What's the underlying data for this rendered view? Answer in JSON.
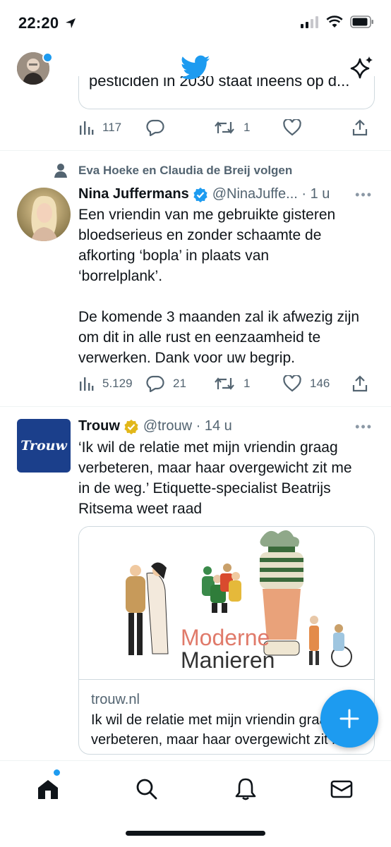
{
  "status_bar": {
    "time": "22:20"
  },
  "top_tweet": {
    "card_text": "pesticiden in 2030 staat ineens op d...",
    "views": "117",
    "replies": "",
    "retweets": "1",
    "likes": ""
  },
  "tweet1": {
    "context": "Eva Hoeke en Claudia de Breij volgen",
    "name": "Nina Juffermans",
    "handle": "@NinaJuffe... · 1 u",
    "body": "Een vriendin van me gebruikte gisteren\nbloedserieus en zonder schaamte de\nafkorting ‘bopla’ in plaats van\n‘borrelplank’.\n\nDe komende 3 maanden zal ik afwezig zijn\nom dit in alle rust en eenzaamheid te\nverwerken. Dank voor uw begrip.",
    "views": "5.129",
    "replies": "21",
    "retweets": "1",
    "likes": "146"
  },
  "tweet2": {
    "name": "Trouw",
    "handle": "@trouw · 14 u",
    "avatar_text": "Trouw",
    "body": "‘Ik wil de relatie met mijn vriendin graag\nverbeteren, maar haar overgewicht zit me\nin de weg.’ Etiquette-specialist Beatrijs\nRitsema weet raad",
    "image_line1": "Moderne",
    "image_line2": "Manieren",
    "link_domain": "trouw.nl",
    "link_title_1": "Ik wil de relatie met mijn vriendin graag",
    "link_title_2": "verbeteren, maar haar overgewicht zit me"
  },
  "more_label": "•••",
  "colors": {
    "accent": "#1d9bf0",
    "text": "#0f1419",
    "muted": "#536471",
    "trouw_blue": "#1b3f8b"
  },
  "nav": [
    "home-icon",
    "search-icon",
    "bell-icon",
    "mail-icon"
  ]
}
